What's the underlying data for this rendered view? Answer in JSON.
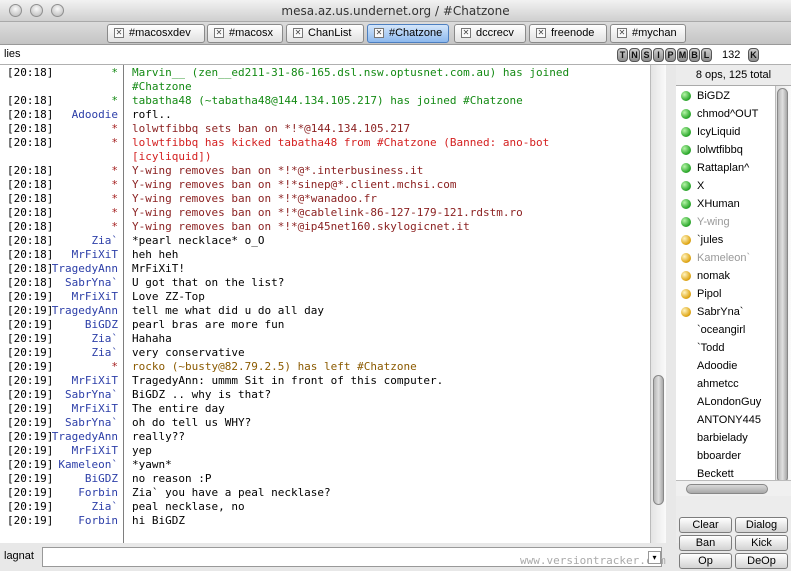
{
  "window": {
    "title": "mesa.az.us.undernet.org / #Chatzone"
  },
  "tabs": [
    {
      "label": "#macosxdev"
    },
    {
      "label": "#macosx"
    },
    {
      "label": "ChanList"
    },
    {
      "label": "#Chatzone"
    },
    {
      "label": "dccrecv"
    },
    {
      "label": "freenode"
    },
    {
      "label": "#mychan"
    }
  ],
  "tab_close_glyph": "✕",
  "topic": {
    "text": "lies"
  },
  "modes": [
    "T",
    "N",
    "S",
    "I",
    "P",
    "M",
    "B",
    "L"
  ],
  "limit": {
    "value": "132",
    "key_label": "K"
  },
  "chat": [
    {
      "ts": "[20:18]",
      "nick": "*",
      "msg": "Marvin__ (zen__ed211-31-86-165.dsl.nsw.optusnet.com.au) has joined",
      "kind": "join"
    },
    {
      "ts": "",
      "nick": "",
      "msg": "#Chatzone",
      "kind": "join"
    },
    {
      "ts": "[20:18]",
      "nick": "*",
      "msg": "tabatha48 (~tabatha48@144.134.105.217) has joined #Chatzone",
      "kind": "join"
    },
    {
      "ts": "[20:18]",
      "nick": "Adoodie",
      "msg": "rofl..",
      "kind": "normal"
    },
    {
      "ts": "[20:18]",
      "nick": "*",
      "msg": "lolwtfibbq sets ban on *!*@144.134.105.217",
      "kind": "server"
    },
    {
      "ts": "[20:18]",
      "nick": "*",
      "msg": "lolwtfibbq has kicked tabatha48 from #Chatzone (Banned: ano-bot",
      "kind": "kick"
    },
    {
      "ts": "",
      "nick": "",
      "msg": "[icyliquid])",
      "kind": "kick"
    },
    {
      "ts": "[20:18]",
      "nick": "*",
      "msg": "Y-wing removes ban on *!*@*.interbusiness.it",
      "kind": "server"
    },
    {
      "ts": "[20:18]",
      "nick": "*",
      "msg": "Y-wing removes ban on *!*sinep@*.client.mchsi.com",
      "kind": "server"
    },
    {
      "ts": "[20:18]",
      "nick": "*",
      "msg": "Y-wing removes ban on *!*@*wanadoo.fr",
      "kind": "server"
    },
    {
      "ts": "[20:18]",
      "nick": "*",
      "msg": "Y-wing removes ban on *!*@cablelink-86-127-179-121.rdstm.ro",
      "kind": "server"
    },
    {
      "ts": "[20:18]",
      "nick": "*",
      "msg": "Y-wing removes ban on *!*@ip45net160.skylogicnet.it",
      "kind": "server"
    },
    {
      "ts": "[20:18]",
      "nick": "Zia`",
      "msg": "*pearl necklace* o_O",
      "kind": "normal"
    },
    {
      "ts": "[20:18]",
      "nick": "MrFiXiT",
      "msg": "heh heh",
      "kind": "normal"
    },
    {
      "ts": "[20:18]",
      "nick": "TragedyAnn",
      "msg": "MrFiXiT!",
      "kind": "normal"
    },
    {
      "ts": "[20:18]",
      "nick": "SabrYna`",
      "msg": "U got that on the list?",
      "kind": "normal"
    },
    {
      "ts": "[20:19]",
      "nick": "MrFiXiT",
      "msg": "Love ZZ-Top",
      "kind": "normal"
    },
    {
      "ts": "[20:19]",
      "nick": "TragedyAnn",
      "msg": "tell me what did u do all day",
      "kind": "normal"
    },
    {
      "ts": "[20:19]",
      "nick": "BiGDZ",
      "msg": "pearl bras are more fun",
      "kind": "normal"
    },
    {
      "ts": "[20:19]",
      "nick": "Zia`",
      "msg": "Hahaha",
      "kind": "normal"
    },
    {
      "ts": "[20:19]",
      "nick": "Zia`",
      "msg": "very conservative",
      "kind": "normal"
    },
    {
      "ts": "[20:19]",
      "nick": "*",
      "msg": "rocko (~busty@82.79.2.5) has left #Chatzone",
      "kind": "part"
    },
    {
      "ts": "[20:19]",
      "nick": "MrFiXiT",
      "msg": "TragedyAnn: ummm Sit in front of this computer.",
      "kind": "normal"
    },
    {
      "ts": "[20:19]",
      "nick": "SabrYna`",
      "msg": "BiGDZ .. why is that?",
      "kind": "normal"
    },
    {
      "ts": "[20:19]",
      "nick": "MrFiXiT",
      "msg": "The entire day",
      "kind": "normal"
    },
    {
      "ts": "[20:19]",
      "nick": "SabrYna`",
      "msg": "oh do tell us WHY?",
      "kind": "normal"
    },
    {
      "ts": "[20:19]",
      "nick": "TragedyAnn",
      "msg": "really??",
      "kind": "normal"
    },
    {
      "ts": "[20:19]",
      "nick": "MrFiXiT",
      "msg": "yep",
      "kind": "normal"
    },
    {
      "ts": "[20:19]",
      "nick": "Kameleon`",
      "msg": "*yawn*",
      "kind": "normal"
    },
    {
      "ts": "[20:19]",
      "nick": "BiGDZ",
      "msg": "no reason :P",
      "kind": "normal"
    },
    {
      "ts": "[20:19]",
      "nick": "Forbin",
      "msg": "Zia` you have a peal necklase?",
      "kind": "normal"
    },
    {
      "ts": "[20:19]",
      "nick": "Zia`",
      "msg": "peal necklase, no",
      "kind": "normal"
    },
    {
      "ts": "[20:19]",
      "nick": "Forbin",
      "msg": "hi BiGDZ",
      "kind": "normal"
    }
  ],
  "userlist": {
    "header": "8 ops, 125 total",
    "users": [
      {
        "name": "BiGDZ",
        "status": "op",
        "away": false
      },
      {
        "name": "chmod^OUT",
        "status": "op",
        "away": false
      },
      {
        "name": "IcyLiquid",
        "status": "op",
        "away": false
      },
      {
        "name": "lolwtfibbq",
        "status": "op",
        "away": false
      },
      {
        "name": "Rattaplan^",
        "status": "op",
        "away": false
      },
      {
        "name": "X",
        "status": "op",
        "away": false
      },
      {
        "name": "XHuman",
        "status": "op",
        "away": false
      },
      {
        "name": "Y-wing",
        "status": "op",
        "away": true
      },
      {
        "name": "`jules",
        "status": "voice",
        "away": false
      },
      {
        "name": "Kameleon`",
        "status": "voice",
        "away": true
      },
      {
        "name": "nomak",
        "status": "voice",
        "away": false
      },
      {
        "name": "Pipol",
        "status": "voice",
        "away": false
      },
      {
        "name": "SabrYna`",
        "status": "voice",
        "away": false
      },
      {
        "name": "`oceangirl",
        "status": "none",
        "away": false
      },
      {
        "name": "`Todd",
        "status": "none",
        "away": false
      },
      {
        "name": "Adoodie",
        "status": "none",
        "away": false
      },
      {
        "name": "ahmetcc",
        "status": "none",
        "away": false
      },
      {
        "name": "ALondonGuy",
        "status": "none",
        "away": false
      },
      {
        "name": "ANTONY445",
        "status": "none",
        "away": false
      },
      {
        "name": "barbielady",
        "status": "none",
        "away": false
      },
      {
        "name": "bboarder",
        "status": "none",
        "away": false
      },
      {
        "name": "Beckett",
        "status": "none",
        "away": false
      }
    ]
  },
  "actions": {
    "clear": "Clear",
    "dialog": "Dialog",
    "ban": "Ban",
    "kick": "Kick",
    "op": "Op",
    "deop": "DeOp"
  },
  "input": {
    "nick": "lagnat",
    "value": ""
  },
  "watermark": "www.versiontracker.com",
  "menu_glyph": "▾",
  "colors": {
    "join": "#148a14",
    "kick": "#d42020",
    "nick": "#2c3ea8",
    "active_tab": "#8db9ee"
  }
}
